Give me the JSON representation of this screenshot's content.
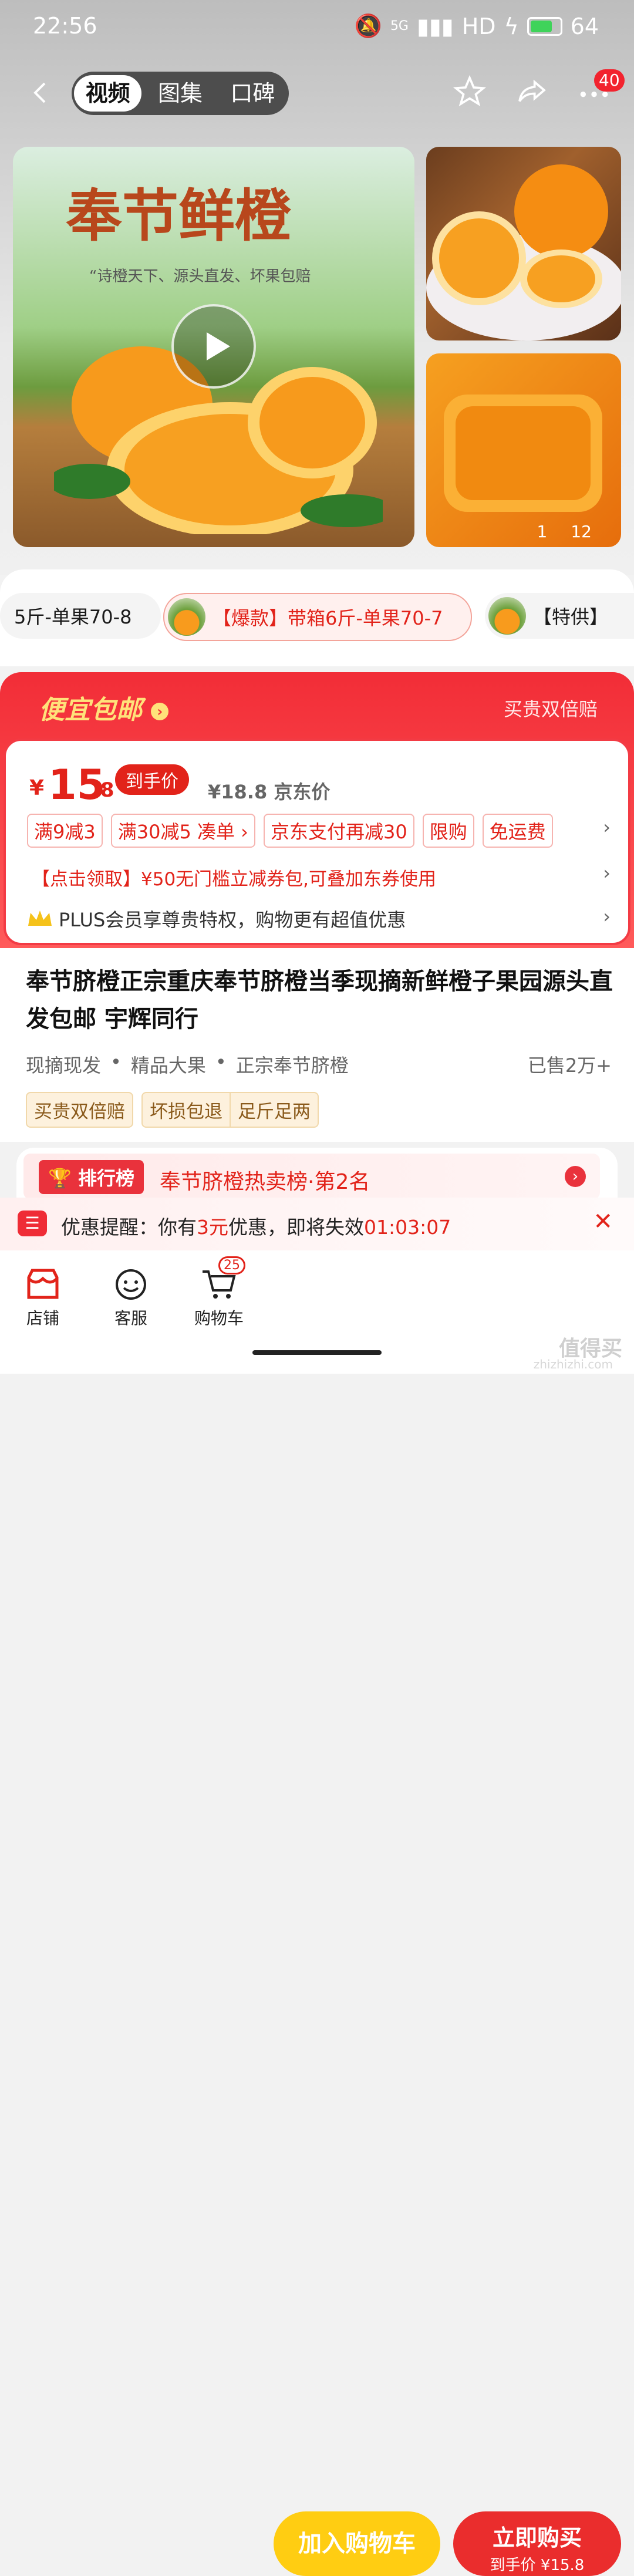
{
  "status_bar": {
    "time": "22:56",
    "network": "5G",
    "hd": "HD",
    "battery": "64"
  },
  "top_nav": {
    "tabs": [
      "视频",
      "图集",
      "口碑"
    ],
    "notification_count": "40"
  },
  "gallery": {
    "banner_title": "奉节鲜橙",
    "banner_slogan": "“诗橙天下、源头直发、坏果包赔",
    "image_index": "1",
    "image_total": "12"
  },
  "variants": [
    {
      "label": "5斤-单果70-8"
    },
    {
      "label": "【爆款】带箱6斤-单果70-7"
    },
    {
      "label": "【特供】"
    }
  ],
  "promo": {
    "title": "便宜包邮",
    "right_text": "买贵双倍赔",
    "price_symbol": "¥",
    "price_int": "15",
    "price_dec": ".8",
    "price_tag": "到手价",
    "orig_price": "¥18.8 京东价",
    "coupons": [
      "满9减3",
      "满30减5  凑单 ›",
      "京东支付再减30",
      "限购",
      "免运费"
    ],
    "coupon_line": "【点击领取】¥50无门槛立减券包,可叠加东券使用",
    "plus_line": "PLUS会员享尊贵特权，购物更有超值优惠"
  },
  "product": {
    "title": "奉节脐橙正宗重庆奉节脐橙当季现摘新鲜橙子果园源头直发包邮 宇辉同行",
    "features": [
      "现摘现发",
      "精品大果",
      "正宗奉节脐橙"
    ],
    "sold": "已售2万+",
    "guarantees": [
      "买贵双倍赔",
      "坏损包退",
      "足斤足两"
    ]
  },
  "ranking": {
    "badge": "排行榜",
    "text": "奉节脐橙热卖榜·第2名"
  },
  "reminder": {
    "prefix": "优惠提醒：你有",
    "amount": "3元",
    "middle": "优惠，即将失效",
    "countdown": "01:03:07"
  },
  "bottom": {
    "store": "店铺",
    "service": "客服",
    "cart": "购物车",
    "cart_count": "25",
    "add_cart": "加入购物车",
    "buy_now": "立即购买",
    "buy_price": "到手价 ¥15.8"
  },
  "watermark": {
    "text": "值得买",
    "sub": "zhizhizhi.com"
  }
}
